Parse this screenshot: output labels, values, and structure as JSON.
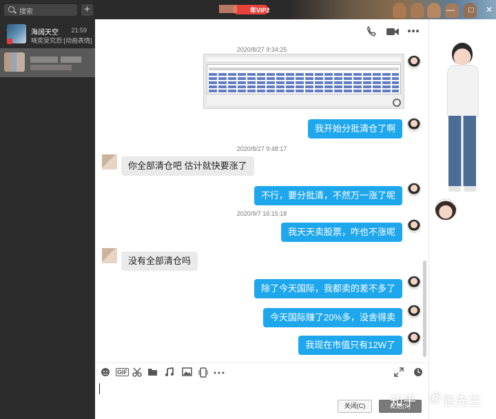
{
  "sidebar": {
    "search_placeholder": "搜索",
    "add_label": "+",
    "conversations": [
      {
        "name": "海阔天空",
        "time": "21:59",
        "preview": "嘀奕旻究恐:[动画表情]"
      }
    ]
  },
  "titlebar": {
    "vip_label": "年VIP2",
    "controls": {
      "minimize": "—",
      "maximize": "□",
      "close": "✕"
    }
  },
  "chat": {
    "header_icons": [
      "phone-icon",
      "video-call-icon",
      "more-icon"
    ],
    "timestamps": [
      "2020/8/27 9:34:25",
      "2020/8/27 9:48:17",
      "2020/9/7 16:15:18"
    ],
    "messages": [
      {
        "side": "right",
        "text": "我开始分批清仓了啊"
      },
      {
        "side": "left",
        "text": "你全部清仓吧 估计就快要涨了"
      },
      {
        "side": "right",
        "text": "不行，要分批清，不然万一涨了呢"
      },
      {
        "side": "right",
        "text": "我天天卖股票，咋也不涨呢"
      },
      {
        "side": "left",
        "text": "没有全部清仓吗"
      },
      {
        "side": "right",
        "text": "除了今天国际，我都卖的差不多了"
      },
      {
        "side": "right",
        "text": "今天国际赚了20%多，没舍得卖"
      },
      {
        "side": "right",
        "text": "我现在市值只有12W了"
      }
    ]
  },
  "toolbar": {
    "icons": [
      "emoji-icon",
      "gif-icon",
      "scissors-icon",
      "folder-icon",
      "music-icon",
      "image-icon",
      "phone-screen-icon",
      "more-icon",
      "expand-icon",
      "history-icon"
    ],
    "gif_label": "GIF",
    "close_button": "关闭(C)",
    "send_button": "发送(S)"
  },
  "watermark": {
    "site": "知乎",
    "at": "@",
    "author": "张先生"
  },
  "colors": {
    "bubble_right": "#1ea7ed",
    "bubble_left": "#eaeaea",
    "sidebar_bg": "#2d2c2c"
  }
}
